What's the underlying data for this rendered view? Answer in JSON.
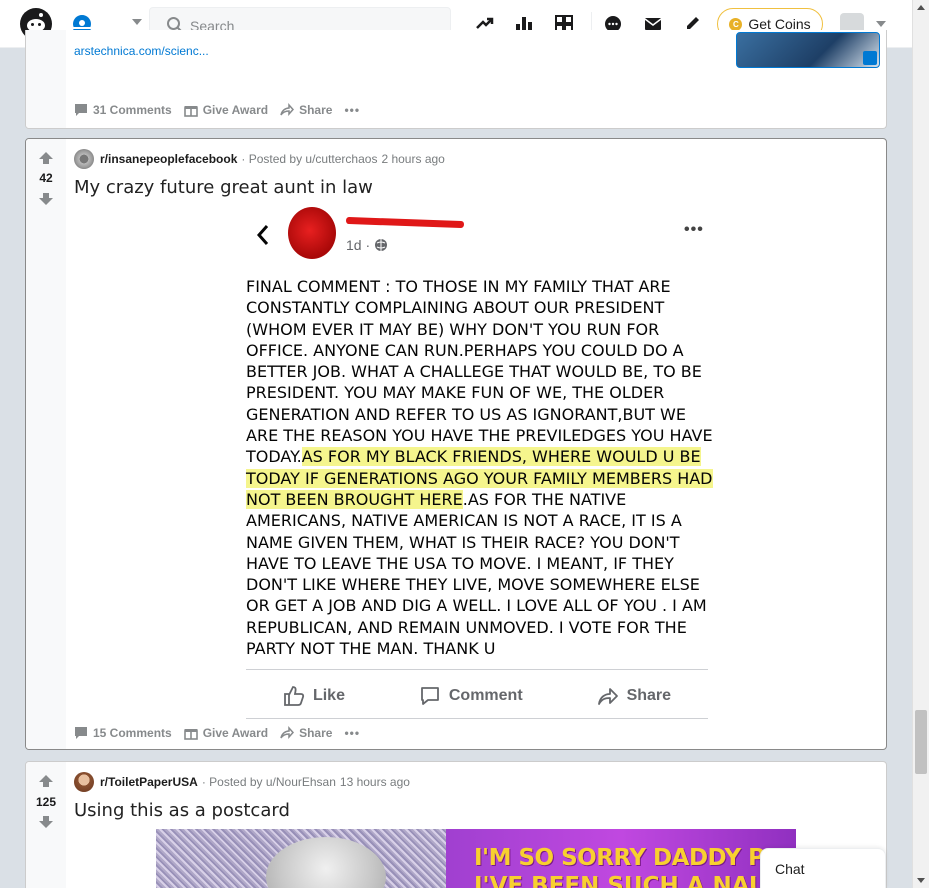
{
  "header": {
    "search_placeholder": "Search",
    "get_coins_label": "Get Coins",
    "coin_glyph": "C"
  },
  "post_prev": {
    "link_url": "arstechnica.com/scienc...",
    "comments_label": "31 Comments",
    "give_award_label": "Give Award",
    "share_label": "Share"
  },
  "post_main": {
    "score": "42",
    "subreddit": "r/insanepeoplefacebook",
    "posted_by": "· Posted by u/cutterchaos",
    "time": "2 hours ago",
    "title": "My crazy future great aunt in law",
    "comments_label": "15 Comments",
    "give_award_label": "Give Award",
    "share_label": "Share",
    "fb": {
      "time": "1d ·",
      "text_before": "FINAL COMMENT : TO THOSE IN MY FAMILY THAT ARE CONSTANTLY COMPLAINING ABOUT OUR PRESIDENT (WHOM EVER IT MAY BE) WHY DON'T YOU RUN FOR OFFICE. ANYONE CAN RUN.PERHAPS YOU COULD DO A BETTER JOB. WHAT A  CHALLEGE THAT WOULD BE, TO BE PRESIDENT. YOU MAY MAKE FUN OF WE, THE OLDER GENERATION AND REFER TO US AS IGNORANT,BUT WE ARE THE REASON YOU HAVE THE PREVILEDGES YOU HAVE TODAY.",
      "text_highlight": "AS FOR MY BLACK FRIENDS, WHERE WOULD U BE TODAY IF GENERATIONS AGO YOUR FAMILY MEMBERS HAD NOT BEEN BROUGHT HERE",
      "text_after": ".AS FOR THE NATIVE AMERICANS, NATIVE AMERICAN IS NOT A RACE, IT IS A NAME GIVEN THEM, WHAT IS THEIR RACE? YOU DON'T HAVE TO LEAVE THE USA TO MOVE. I MEANT, IF THEY DON'T LIKE WHERE THEY LIVE, MOVE SOMEWHERE ELSE OR GET A JOB AND DIG A WELL.  I LOVE ALL OF YOU . I AM REPUBLICAN, AND REMAIN UNMOVED. I VOTE FOR THE PARTY NOT THE MAN.  THANK U",
      "like_label": "Like",
      "comment_label": "Comment",
      "share_label": "Share"
    }
  },
  "post_next": {
    "score": "125",
    "subreddit": "r/ToiletPaperUSA",
    "posted_by": "· Posted by u/NourEhsan",
    "time": "13 hours ago",
    "title": "Using this as a postcard",
    "caption_line1": "I'M SO SORRY DADDY PARGER,",
    "caption_line2": "I'VE BEEN SUCH A NAUGHTY GIRL"
  },
  "chat": {
    "label": "Chat"
  },
  "colors": {
    "accent": "#0079d3",
    "coin": "#e8b127",
    "highlight": "#f0f050"
  }
}
